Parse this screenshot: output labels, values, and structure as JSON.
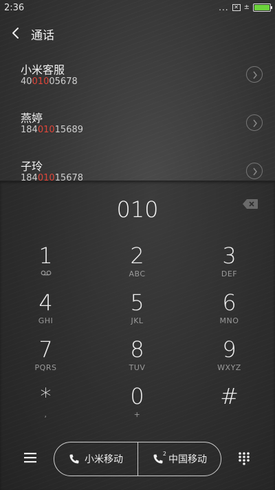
{
  "status_bar": {
    "time": "2:36",
    "dots": "...",
    "charge_symbol": "±",
    "battery_color": "#6cd33c"
  },
  "header": {
    "title": "通话"
  },
  "contacts": [
    {
      "name": "小米客服",
      "number_prefix": "40",
      "number_match": "010",
      "number_suffix": "05678"
    },
    {
      "name": "燕婷",
      "number_prefix": "184",
      "number_match": "010",
      "number_suffix": "15689"
    },
    {
      "name": "子玲",
      "number_prefix": "184",
      "number_match": "010",
      "number_suffix": "15678"
    }
  ],
  "dialpad": {
    "dialed_number": "010",
    "keys": [
      {
        "digit": "1",
        "letters": ""
      },
      {
        "digit": "2",
        "letters": "ABC"
      },
      {
        "digit": "3",
        "letters": "DEF"
      },
      {
        "digit": "4",
        "letters": "GHI"
      },
      {
        "digit": "5",
        "letters": "JKL"
      },
      {
        "digit": "6",
        "letters": "MNO"
      },
      {
        "digit": "7",
        "letters": "PQRS"
      },
      {
        "digit": "8",
        "letters": "TUV"
      },
      {
        "digit": "9",
        "letters": "WXYZ"
      },
      {
        "digit": "*",
        "letters": ","
      },
      {
        "digit": "0",
        "letters": "+"
      },
      {
        "digit": "#",
        "letters": ""
      }
    ]
  },
  "bottom_bar": {
    "sim1_label": "小米移动",
    "sim2_label": "中国移动",
    "sim2_number": "2"
  },
  "colors": {
    "highlight": "#e0463a"
  }
}
